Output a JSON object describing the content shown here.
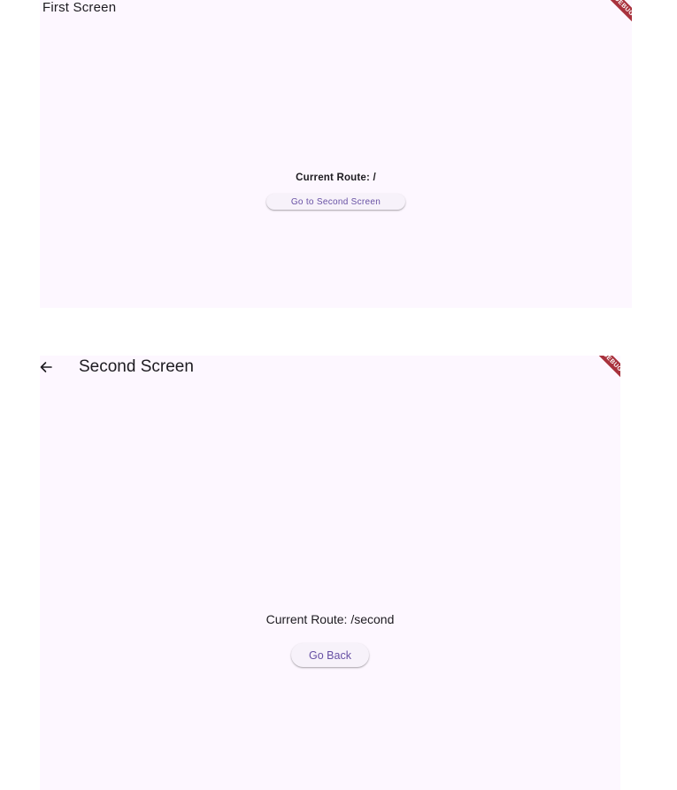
{
  "first_screen": {
    "title": "First Screen",
    "route_text": "Current Route: /",
    "button_label": "Go to Second Screen",
    "debug_banner": "DEBUG"
  },
  "second_screen": {
    "title": "Second Screen",
    "back_icon": "arrow-back-icon",
    "route_text": "Current Route: /second",
    "button_label": "Go Back",
    "debug_banner": "DEBUG"
  },
  "colors": {
    "surface": "#fdf7ff",
    "button_bg": "#f7f2fa",
    "button_text": "#6750a4",
    "on_surface": "#1d1b20",
    "debug_banner": "#a8313c"
  }
}
